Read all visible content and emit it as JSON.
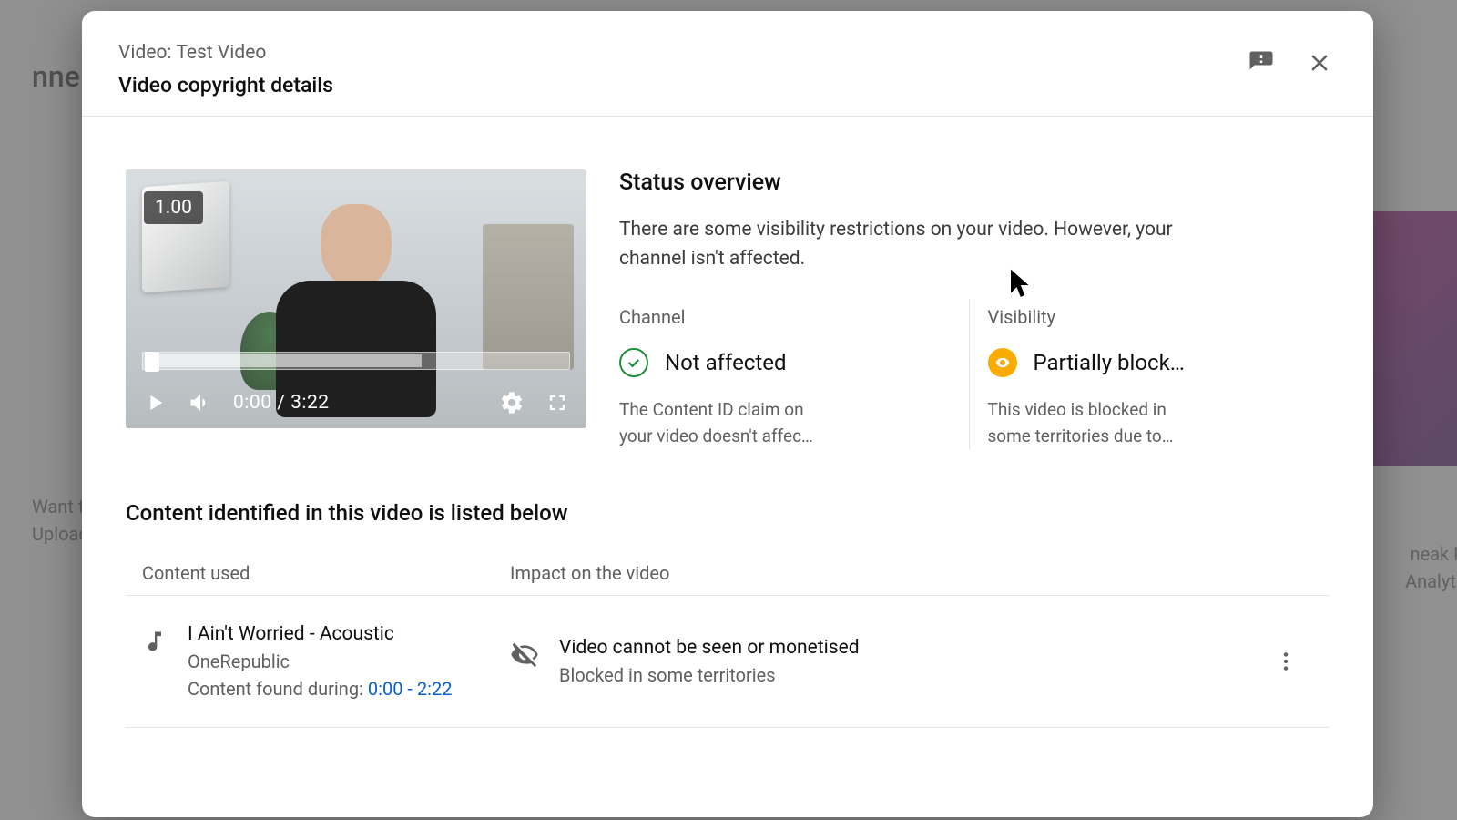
{
  "background": {
    "page_title_fragment": "nnel d",
    "left_line1": "Want t",
    "left_line2": "Upload",
    "right_line1": "neak Peek",
    "right_line2": "Analytics c"
  },
  "header": {
    "video_label": "Video: Test Video",
    "title": "Video copyright details"
  },
  "player": {
    "speed": "1.00",
    "time": "0:00 / 3:22"
  },
  "status": {
    "heading": "Status overview",
    "description": "There are some visibility restrictions on your video. However, your channel isn't affected.",
    "channel": {
      "label": "Channel",
      "value": "Not affected",
      "sub": "The Content ID claim on your video doesn't affec…"
    },
    "visibility": {
      "label": "Visibility",
      "value": "Partially block…",
      "sub": "This video is blocked in some territories due to…"
    }
  },
  "content": {
    "heading": "Content identified in this video is listed below",
    "columns": {
      "used": "Content used",
      "impact": "Impact on the video"
    },
    "row": {
      "track_title": "I Ain't Worried - Acoustic",
      "artist": "OneRepublic",
      "found_prefix": "Content found during: ",
      "found_range": "0:00 - 2:22",
      "impact_title": "Video cannot be seen or monetised",
      "impact_sub": "Blocked in some territories"
    }
  }
}
